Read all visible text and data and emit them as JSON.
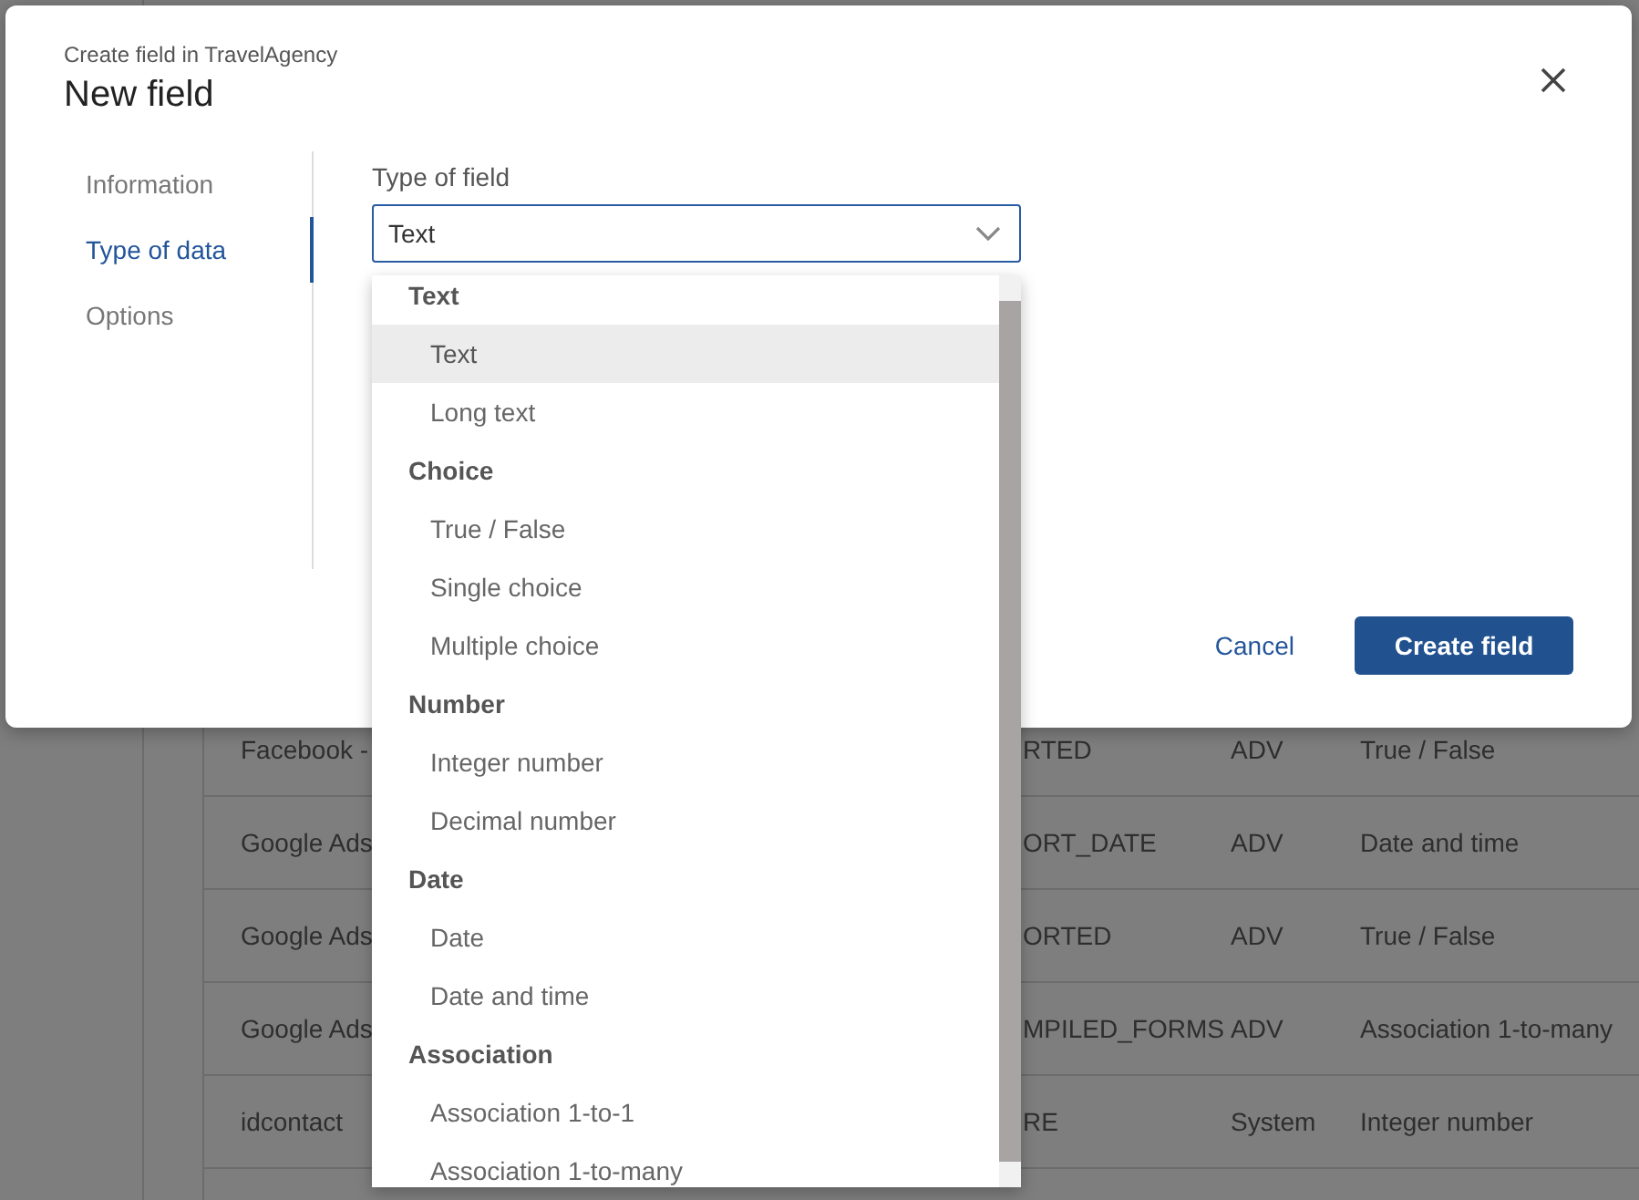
{
  "background_table": {
    "rows": [
      {
        "column_1": "Facebook -",
        "column_2": "RTED",
        "column_3": "ADV",
        "column_4": "True / False"
      },
      {
        "column_1": "Google Ads",
        "column_2": "ORT_DATE",
        "column_3": "ADV",
        "column_4": "Date and time"
      },
      {
        "column_1": "Google Ads",
        "column_2": "ORTED",
        "column_3": "ADV",
        "column_4": "True / False"
      },
      {
        "column_1": "Google Ads",
        "column_2": "MPILED_FORMS",
        "column_3": "ADV",
        "column_4": "Association 1-to-many"
      },
      {
        "column_1": "idcontact",
        "column_2": "RE",
        "column_3": "System",
        "column_4": "Integer number"
      }
    ]
  },
  "dialog": {
    "subtitle": "Create field in TravelAgency",
    "title": "New field",
    "steps": [
      {
        "label": "Information",
        "selected": false
      },
      {
        "label": "Type of data",
        "selected": true
      },
      {
        "label": "Options",
        "selected": false
      }
    ],
    "field_label": "Type of field",
    "select_value": "Text",
    "dropdown": {
      "groups": [
        {
          "label": "Text",
          "items": [
            {
              "label": "Text",
              "selected": true
            },
            {
              "label": "Long text",
              "selected": false
            }
          ]
        },
        {
          "label": "Choice",
          "items": [
            {
              "label": "True / False",
              "selected": false
            },
            {
              "label": "Single choice",
              "selected": false
            },
            {
              "label": "Multiple choice",
              "selected": false
            }
          ]
        },
        {
          "label": "Number",
          "items": [
            {
              "label": "Integer number",
              "selected": false
            },
            {
              "label": "Decimal number",
              "selected": false
            }
          ]
        },
        {
          "label": "Date",
          "items": [
            {
              "label": "Date",
              "selected": false
            },
            {
              "label": "Date and time",
              "selected": false
            }
          ]
        },
        {
          "label": "Association",
          "items": [
            {
              "label": "Association 1-to-1",
              "selected": false
            },
            {
              "label": "Association 1-to-many",
              "selected": false
            }
          ]
        }
      ]
    },
    "buttons": [
      {
        "label": "Cancel",
        "kind": "link"
      },
      {
        "label": "Create field",
        "kind": "primary"
      }
    ]
  }
}
